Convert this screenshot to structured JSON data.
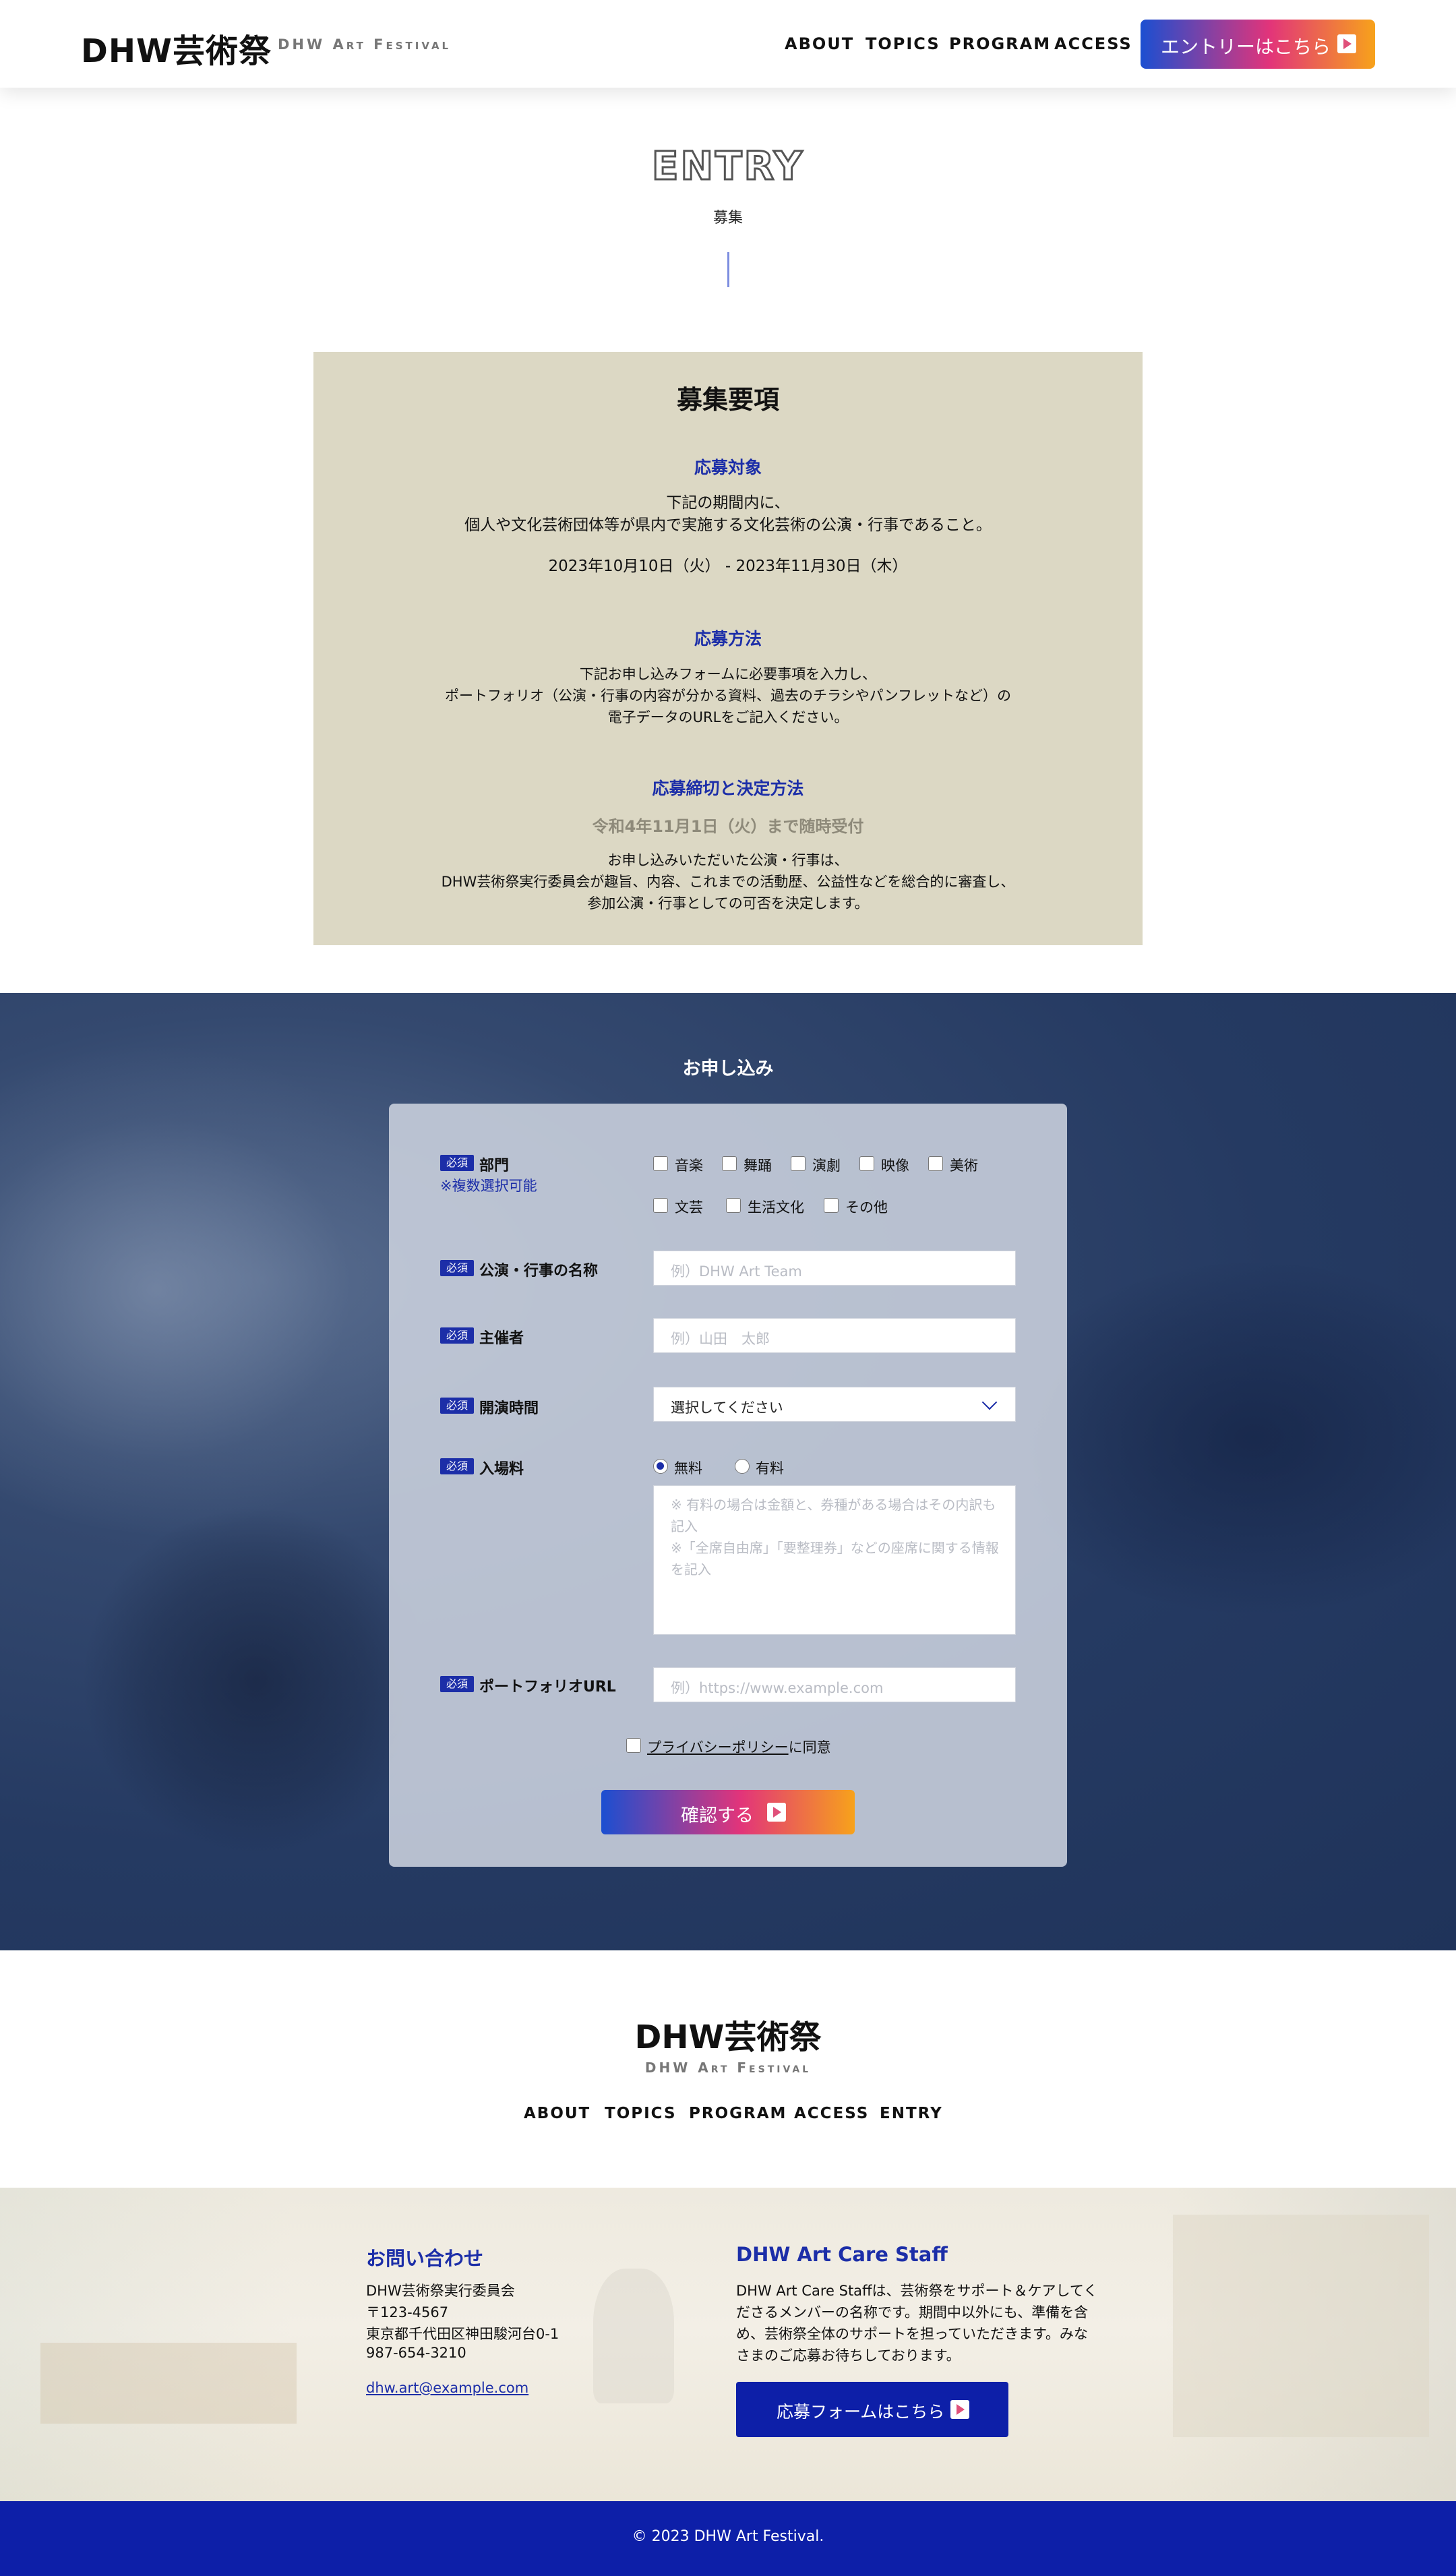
{
  "header": {
    "logo": "DHW芸術祭",
    "logo_sub": "DHW Art Festival",
    "nav": [
      "ABOUT",
      "TOPICS",
      "PROGRAM",
      "ACCESS"
    ],
    "entry_button": "エントリーはこちら",
    "brand_gradient": [
      "#1b4fd1",
      "#e2347a",
      "#f7a21b"
    ]
  },
  "entry": {
    "title": "ENTRY",
    "subtitle": "募集"
  },
  "requirements": {
    "title": "募集要項",
    "target_heading": "応募対象",
    "target_line1": "下記の期間内に、",
    "target_line2": "個人や文化芸術団体等が県内で実施する文化芸術の公演・行事であること。",
    "period": "2023年10月10日（火） - 2023年11月30日（木）",
    "method_heading": "応募方法",
    "method_line1": "下記お申し込みフォームに必要事項を入力し、",
    "method_line2": "ポートフォリオ（公演・行事の内容が分かる資料、過去のチラシやパンフレットなど）の",
    "method_line3": "電子データのURLをご記入ください。",
    "deadline_heading": "応募締切と決定方法",
    "deadline": "令和4年11月1日（火）まで随時受付",
    "decision_line1": "お申し込みいただいた公演・行事は、",
    "decision_line2": "DHW芸術祭実行委員会が趣旨、内容、これまでの活動歴、公益性などを総合的に審査し、",
    "decision_line3": "参加公演・行事としての可否を決定します。",
    "box_color": "#dcd8c4",
    "accent_color": "#1c2ea8"
  },
  "form": {
    "heading": "お申し込み",
    "required_badge": "必須",
    "category_label": "部門",
    "category_note": "※複数選択可能",
    "categories": [
      "音楽",
      "舞踊",
      "演劇",
      "映像",
      "美術",
      "文芸",
      "生活文化",
      "その他"
    ],
    "event_name_label": "公演・行事の名称",
    "event_name_placeholder": "例）DHW Art Team",
    "organizer_label": "主催者",
    "organizer_placeholder": "例）山田　太郎",
    "time_label": "開演時間",
    "time_value": "選択してください",
    "fee_label": "入場料",
    "fee_options": [
      "無料",
      "有料"
    ],
    "fee_selected": "無料",
    "fee_placeholder_1": "※ 有料の場合は金額と、券種がある場合はその内訳も記入",
    "fee_placeholder_2": "※「全席自由席」「要整理券」などの座席に関する情報を記入",
    "portfolio_label": "ポートフォリオURL",
    "portfolio_placeholder": "例）https://www.example.com",
    "privacy_link": "プライバシーポリシー",
    "privacy_suffix": "に同意",
    "confirm_button": "確認する"
  },
  "footer": {
    "logo": "DHW芸術祭",
    "logo_sub": "DHW Art Festival",
    "nav": [
      "ABOUT",
      "TOPICS",
      "PROGRAM",
      "ACCESS",
      "ENTRY"
    ],
    "contact_heading": "お問い合わせ",
    "contact_org": "DHW芸術祭実行委員会",
    "contact_zip": "〒123-4567",
    "contact_address": "東京都千代田区神田駿河台0-1",
    "contact_phone": "987-654-3210",
    "contact_email": "dhw.art@example.com",
    "staff_heading": "DHW Art Care Staff",
    "staff_text": "DHW Art Care Staffは、芸術祭をサポート＆ケアしてくださるメンバーの名称です。期間中以外にも、準備を含め、芸術祭全体のサポートを担っていただきます。みなさまのご応募お待ちしております。",
    "staff_button": "応募フォームはこちら",
    "copyright": "© 2023 DHW Art Festival.",
    "bar_color": "#0d1fa8"
  }
}
